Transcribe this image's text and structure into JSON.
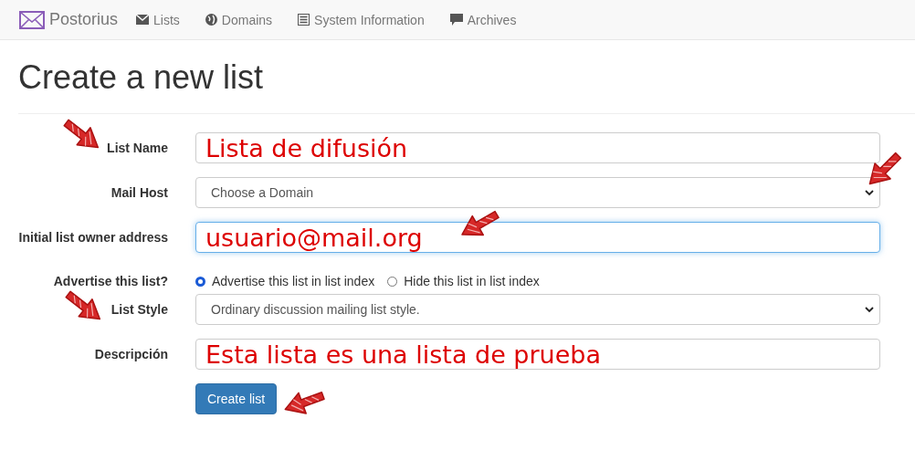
{
  "navbar": {
    "brand": "Postorius",
    "links": [
      {
        "label": "Lists"
      },
      {
        "label": "Domains"
      },
      {
        "label": "System Information"
      },
      {
        "label": "Archives"
      }
    ]
  },
  "title": "Create a new list",
  "form": {
    "rows": [
      {
        "kind": "text",
        "label": "List Name",
        "value": "Lista de difusión",
        "focused": false
      },
      {
        "kind": "select",
        "label": "Mail Host",
        "value": "Choose a Domain"
      },
      {
        "kind": "text",
        "label": "Initial list owner address",
        "value": "usuario@mail.org",
        "focused": true
      },
      {
        "kind": "radio",
        "label": "Advertise this list?",
        "options": [
          {
            "label": "Advertise this list in list index",
            "selected": true
          },
          {
            "label": "Hide this list in list index",
            "selected": false
          }
        ]
      },
      {
        "kind": "select",
        "label": "List Style",
        "value": "Ordinary discussion mailing list style."
      },
      {
        "kind": "text",
        "label": "Descripción",
        "value": "Esta lista es una lista de prueba",
        "focused": false
      }
    ],
    "submit": "Create list"
  }
}
